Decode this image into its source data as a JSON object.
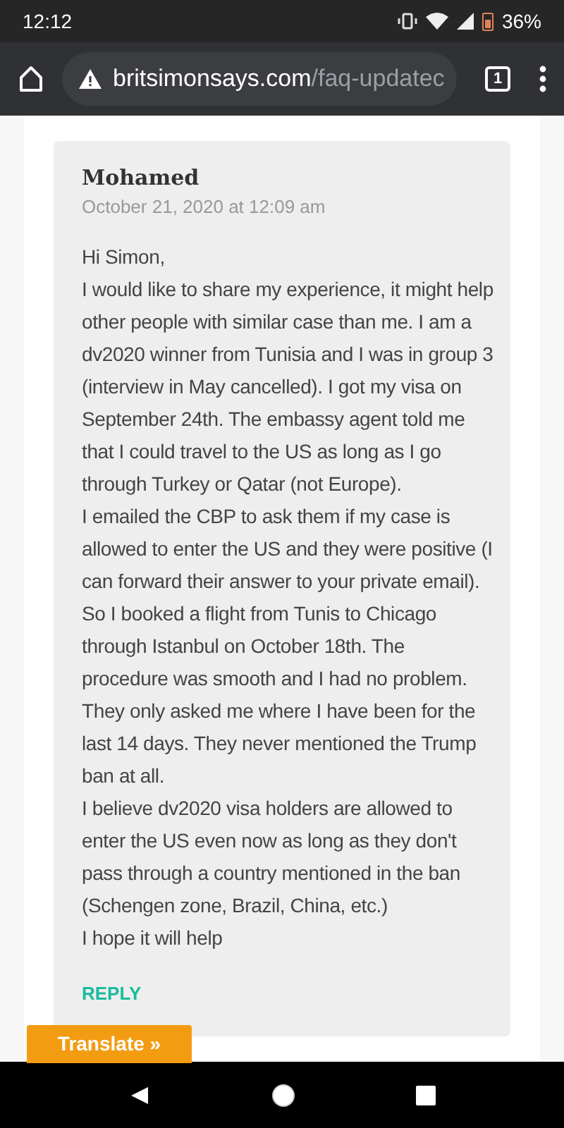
{
  "status_bar": {
    "time": "12:12",
    "battery": "36%"
  },
  "browser": {
    "url_host": "britsimonsays.com",
    "url_path": "/faq-updatec",
    "tab_count": "1"
  },
  "comment": {
    "author": "Mohamed",
    "date": "October 21, 2020 at 12:09 am",
    "paragraphs": [
      "Hi Simon,",
      "I would like to share my experience, it might help other people with similar case than me. I am a dv2020 winner from Tunisia and I was in group 3 (interview in May cancelled). I got my visa on September 24th. The embassy agent told me that I could travel to the US as long as I go through Turkey or Qatar (not Europe).",
      "I emailed the CBP to ask them if my case is allowed to enter the US and they were positive (I can forward their answer to your private email). So I booked a flight from Tunis to Chicago through Istanbul on October 18th. The procedure was smooth and I had no problem. They only asked me where I have been for the last 14 days. They never mentioned the Trump ban at all.",
      "I believe dv2020 visa holders are allowed to enter the US even now as long as they don't pass through a country mentioned in the ban (Schengen zone, Brazil, China, etc.)",
      "I hope it will help"
    ],
    "reply": "REPLY"
  },
  "translate": "Translate »"
}
